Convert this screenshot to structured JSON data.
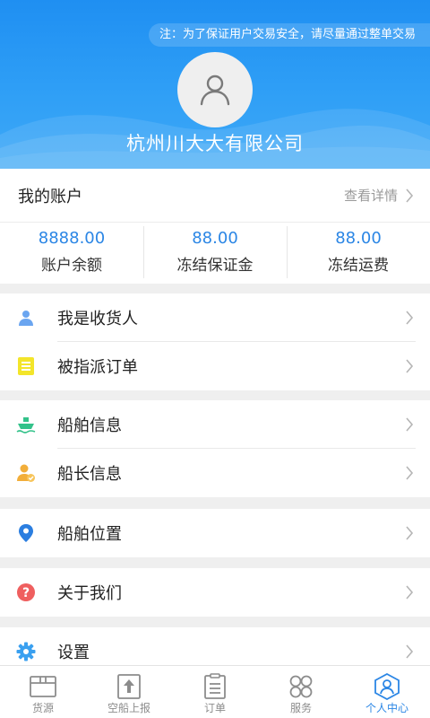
{
  "header": {
    "notice": "注：为了保证用户交易安全，请尽量通过整单交易",
    "avatar_icon": "user-avatar-icon",
    "company_name": "杭州川大大有限公司"
  },
  "account": {
    "title": "我的账户",
    "view_details": "查看详情",
    "stats": [
      {
        "value": "8888.00",
        "label": "账户余额"
      },
      {
        "value": "88.00",
        "label": "冻结保证金"
      },
      {
        "value": "88.00",
        "label": "冻结运费"
      }
    ]
  },
  "menu": {
    "consignee": {
      "label": "我是收货人",
      "icon": "person-icon"
    },
    "assigned_orders": {
      "label": "被指派订单",
      "icon": "document-icon"
    },
    "ship_info": {
      "label": "船舶信息",
      "icon": "ship-icon"
    },
    "captain_info": {
      "label": "船长信息",
      "icon": "captain-check-icon"
    },
    "ship_location": {
      "label": "船舶位置",
      "icon": "location-pin-icon"
    },
    "about_us": {
      "label": "关于我们",
      "icon": "question-icon"
    },
    "settings": {
      "label": "设置",
      "icon": "gear-icon"
    }
  },
  "colors": {
    "accent": "#2b86e5",
    "header_top": "#1f8ff2",
    "header_bottom": "#3ea8f7"
  },
  "tabbar": {
    "items": [
      {
        "label": "货源",
        "icon": "cargo-box-icon",
        "active": false
      },
      {
        "label": "空船上报",
        "icon": "upload-icon",
        "active": false
      },
      {
        "label": "订单",
        "icon": "order-list-icon",
        "active": false
      },
      {
        "label": "服务",
        "icon": "service-grid-icon",
        "active": false
      },
      {
        "label": "个人中心",
        "icon": "profile-icon",
        "active": true
      }
    ]
  }
}
